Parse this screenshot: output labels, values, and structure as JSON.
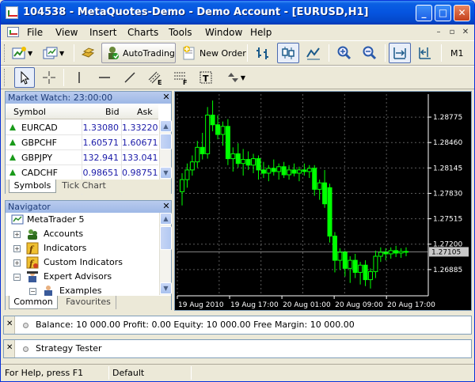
{
  "window": {
    "title": "104538 - MetaQuotes-Demo - Demo Account - [EURUSD,H1]"
  },
  "menu": [
    "File",
    "View",
    "Insert",
    "Charts",
    "Tools",
    "Window",
    "Help"
  ],
  "toolbar": {
    "autotrading_label": "AutoTrading",
    "new_order_label": "New Order",
    "timeframe": "M1"
  },
  "market_watch": {
    "title": "Market Watch: 23:00:00",
    "columns": [
      "Symbol",
      "Bid",
      "Ask"
    ],
    "rows": [
      {
        "symbol": "EURCAD",
        "bid": "1.33080",
        "ask": "1.33220"
      },
      {
        "symbol": "GBPCHF",
        "bid": "1.60571",
        "ask": "1.60671"
      },
      {
        "symbol": "GBPJPY",
        "bid": "132.941",
        "ask": "133.041"
      },
      {
        "symbol": "CADCHF",
        "bid": "0.98651",
        "ask": "0.98751"
      }
    ],
    "tabs": [
      "Symbols",
      "Tick Chart"
    ]
  },
  "navigator": {
    "title": "Navigator",
    "items": [
      {
        "label": "MetaTrader 5",
        "icon": "metatrader-icon"
      },
      {
        "label": "Accounts",
        "icon": "accounts-icon"
      },
      {
        "label": "Indicators",
        "icon": "indicators-icon"
      },
      {
        "label": "Custom Indicators",
        "icon": "custom-indicators-icon"
      },
      {
        "label": "Expert Advisors",
        "icon": "expert-advisors-icon"
      },
      {
        "label": "Examples",
        "icon": "examples-icon"
      }
    ],
    "tabs": [
      "Common",
      "Favourites"
    ]
  },
  "chart": {
    "current_price": "1.27105",
    "colors": {
      "background": "#000000",
      "candle": "#00ff00",
      "grid": "#5a5a5a",
      "text": "#ffffff"
    }
  },
  "chart_data": {
    "type": "candlestick",
    "symbol": "EURUSD",
    "timeframe": "H1",
    "ylim": [
      1.2656,
      1.2906
    ],
    "y_ticks": [
      "1.28775",
      "1.28460",
      "1.28145",
      "1.27830",
      "1.27515",
      "1.27200",
      "1.26885"
    ],
    "x_ticks": [
      "19 Aug 2010",
      "19 Aug 17:00",
      "20 Aug 01:00",
      "20 Aug 09:00",
      "20 Aug 17:00"
    ],
    "current_price": 1.27105,
    "candles": [
      {
        "o": 1.2785,
        "h": 1.2808,
        "l": 1.2768,
        "c": 1.28
      },
      {
        "o": 1.28,
        "h": 1.282,
        "l": 1.279,
        "c": 1.2812
      },
      {
        "o": 1.2812,
        "h": 1.283,
        "l": 1.2805,
        "c": 1.2822
      },
      {
        "o": 1.2822,
        "h": 1.2848,
        "l": 1.2815,
        "c": 1.284
      },
      {
        "o": 1.284,
        "h": 1.2858,
        "l": 1.2825,
        "c": 1.2832
      },
      {
        "o": 1.2832,
        "h": 1.289,
        "l": 1.2826,
        "c": 1.288
      },
      {
        "o": 1.288,
        "h": 1.2898,
        "l": 1.286,
        "c": 1.2868
      },
      {
        "o": 1.2868,
        "h": 1.288,
        "l": 1.285,
        "c": 1.2856
      },
      {
        "o": 1.2856,
        "h": 1.2872,
        "l": 1.2842,
        "c": 1.2866
      },
      {
        "o": 1.2866,
        "h": 1.2875,
        "l": 1.2818,
        "c": 1.2826
      },
      {
        "o": 1.2826,
        "h": 1.284,
        "l": 1.281,
        "c": 1.2832
      },
      {
        "o": 1.2832,
        "h": 1.2845,
        "l": 1.2815,
        "c": 1.282
      },
      {
        "o": 1.282,
        "h": 1.2838,
        "l": 1.2805,
        "c": 1.2825
      },
      {
        "o": 1.2825,
        "h": 1.2835,
        "l": 1.2812,
        "c": 1.2818
      },
      {
        "o": 1.2818,
        "h": 1.2832,
        "l": 1.2808,
        "c": 1.2826
      },
      {
        "o": 1.2826,
        "h": 1.283,
        "l": 1.28,
        "c": 1.2812
      },
      {
        "o": 1.2812,
        "h": 1.2822,
        "l": 1.2802,
        "c": 1.2808
      },
      {
        "o": 1.2808,
        "h": 1.2818,
        "l": 1.2798,
        "c": 1.2814
      },
      {
        "o": 1.2814,
        "h": 1.2825,
        "l": 1.2805,
        "c": 1.281
      },
      {
        "o": 1.281,
        "h": 1.282,
        "l": 1.28,
        "c": 1.2816
      },
      {
        "o": 1.2816,
        "h": 1.2822,
        "l": 1.2802,
        "c": 1.2806
      },
      {
        "o": 1.2806,
        "h": 1.2818,
        "l": 1.28,
        "c": 1.2812
      },
      {
        "o": 1.2812,
        "h": 1.282,
        "l": 1.2804,
        "c": 1.2808
      },
      {
        "o": 1.2808,
        "h": 1.2816,
        "l": 1.2798,
        "c": 1.2812
      },
      {
        "o": 1.2812,
        "h": 1.282,
        "l": 1.2805,
        "c": 1.281
      },
      {
        "o": 1.281,
        "h": 1.2818,
        "l": 1.2802,
        "c": 1.2814
      },
      {
        "o": 1.2814,
        "h": 1.2818,
        "l": 1.278,
        "c": 1.2788
      },
      {
        "o": 1.2788,
        "h": 1.28,
        "l": 1.2775,
        "c": 1.2796
      },
      {
        "o": 1.2796,
        "h": 1.2812,
        "l": 1.2765,
        "c": 1.277
      },
      {
        "o": 1.279,
        "h": 1.2795,
        "l": 1.2722,
        "c": 1.273
      },
      {
        "o": 1.273,
        "h": 1.2735,
        "l": 1.2685,
        "c": 1.27
      },
      {
        "o": 1.27,
        "h": 1.2715,
        "l": 1.2688,
        "c": 1.271
      },
      {
        "o": 1.271,
        "h": 1.2712,
        "l": 1.268,
        "c": 1.269
      },
      {
        "o": 1.269,
        "h": 1.2705,
        "l": 1.2672,
        "c": 1.27
      },
      {
        "o": 1.27,
        "h": 1.2708,
        "l": 1.2678,
        "c": 1.2685
      },
      {
        "o": 1.2685,
        "h": 1.2698,
        "l": 1.267,
        "c": 1.2694
      },
      {
        "o": 1.2694,
        "h": 1.27,
        "l": 1.2668,
        "c": 1.2676
      },
      {
        "o": 1.2676,
        "h": 1.269,
        "l": 1.2665,
        "c": 1.2686
      },
      {
        "o": 1.2686,
        "h": 1.2712,
        "l": 1.2678,
        "c": 1.2705
      },
      {
        "o": 1.2705,
        "h": 1.2716,
        "l": 1.2698,
        "c": 1.271
      },
      {
        "o": 1.271,
        "h": 1.2715,
        "l": 1.27,
        "c": 1.2708
      },
      {
        "o": 1.2708,
        "h": 1.2716,
        "l": 1.2702,
        "c": 1.2712
      },
      {
        "o": 1.2712,
        "h": 1.2718,
        "l": 1.2704,
        "c": 1.2709
      },
      {
        "o": 1.2709,
        "h": 1.2715,
        "l": 1.2703,
        "c": 1.2711
      },
      {
        "o": 1.2711,
        "h": 1.2716,
        "l": 1.2705,
        "c": 1.27105
      }
    ]
  },
  "toolbox": {
    "balance_text": "Balance: 10 000.00  Profit: 0.00  Equity: 10 000.00  Free Margin: 10 000.00",
    "strategy_tester_label": "Strategy Tester"
  },
  "status": {
    "help": "For Help, press F1",
    "profile": "Default"
  }
}
